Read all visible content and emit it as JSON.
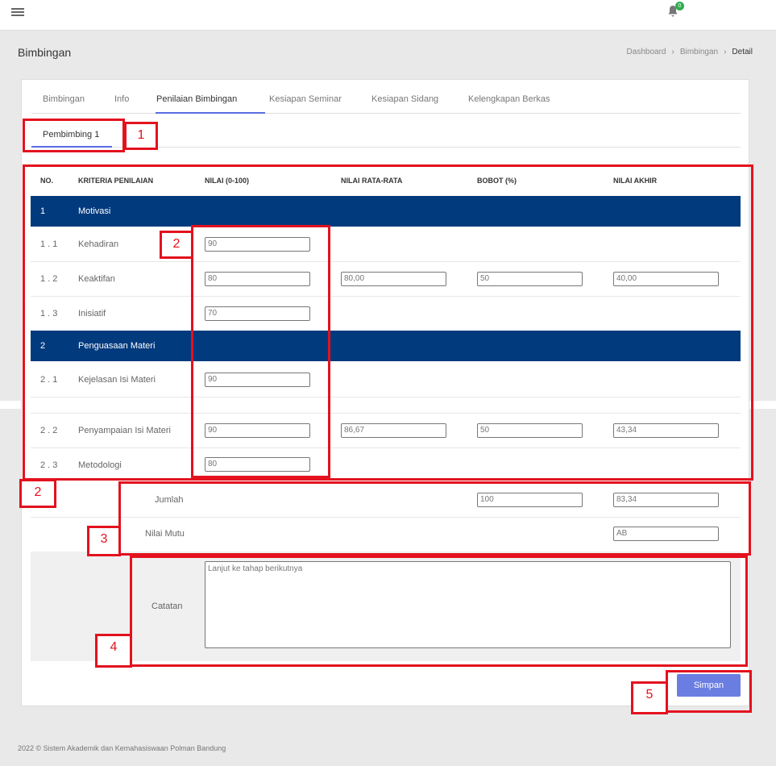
{
  "app": {
    "page_title": "Bimbingan",
    "breadcrumb": [
      "Dashboard",
      "Bimbingan",
      "Detail"
    ],
    "notification_count": "0",
    "footer": "2022 © Sistem Akademik dan Kemahasiswaan Polman Bandung"
  },
  "tabs": [
    "Bimbingan",
    "Info",
    "Penilaian Bimbingan",
    "Kesiapan Seminar",
    "Kesiapan Sidang",
    "Kelengkapan Berkas"
  ],
  "active_tab": "Penilaian Bimbingan",
  "subtab": "Pembimbing 1",
  "table": {
    "headers": [
      "NO.",
      "KRITERIA PENILAIAN",
      "NILAI (0-100)",
      "NILAI RATA-RATA",
      "BOBOT (%)",
      "NILAI AKHIR"
    ],
    "groups": [
      {
        "no": "1",
        "name": "Motivasi",
        "avg": "80,00",
        "bobot": "50",
        "akhir": "40,00",
        "items": [
          {
            "no": "1 . 1",
            "name": "Kehadiran",
            "nilai": "90"
          },
          {
            "no": "1 . 2",
            "name": "Keaktifan",
            "nilai": "80"
          },
          {
            "no": "1 . 3",
            "name": "Inisiatif",
            "nilai": "70"
          }
        ]
      },
      {
        "no": "2",
        "name": "Penguasaan Materi",
        "avg": "86,67",
        "bobot": "50",
        "akhir": "43,34",
        "items": [
          {
            "no": "2 . 1",
            "name": "Kejelasan Isi Materi",
            "nilai": "90"
          },
          {
            "no": "2 . 2",
            "name": "Penyampaian Isi Materi",
            "nilai": "90"
          },
          {
            "no": "2 . 3",
            "name": "Metodologi",
            "nilai": "80"
          }
        ]
      }
    ],
    "jumlah_label": "Jumlah",
    "jumlah_bobot": "100",
    "jumlah_akhir": "83,34",
    "mutu_label": "Nilai Mutu",
    "mutu_value": "AB"
  },
  "catatan_label": "Catatan",
  "catatan_value": "Lanjut ke tahap berikutnya",
  "save_label": "Simpan",
  "annotations": [
    "1",
    "2",
    "2",
    "3",
    "4",
    "5"
  ],
  "colors": {
    "band": "#023a7e",
    "accent": "#5a6ee0",
    "button": "#6a7ee2",
    "annotation": "#e3121e",
    "badge": "#2eae4e"
  }
}
